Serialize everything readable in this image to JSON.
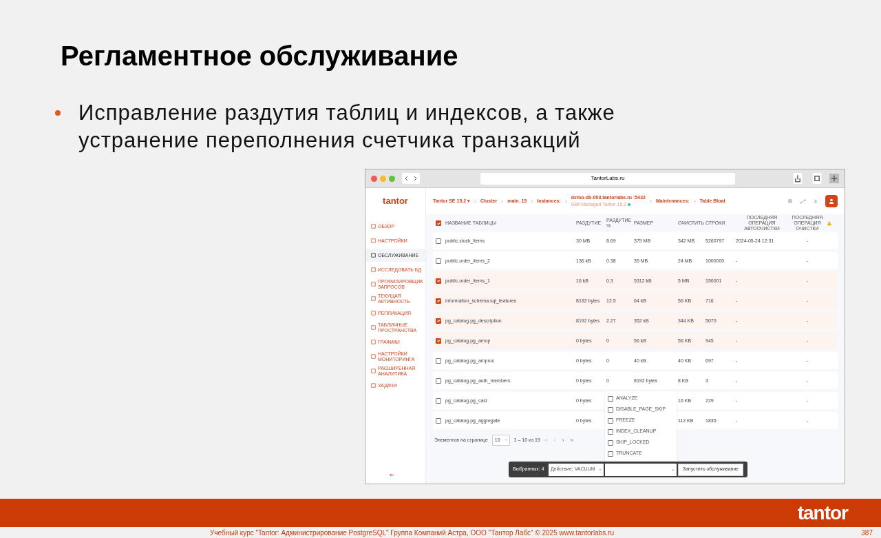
{
  "slide": {
    "title": "Регламентное обслуживание",
    "bullets": [
      "Исправление раздутия таблиц и индексов, а также устранение переполнения счетчика транзакций"
    ],
    "logo": "tantor",
    "footer": "Учебный курс \"Tantor: Администрирование PostgreSQL\" Группа Компаний Астра, ООО \"Тантор Лабс\" © 2025  www.tantorlabs.ru",
    "page_number": "387"
  },
  "browser": {
    "url": "TantorLabs.ru"
  },
  "app": {
    "logo": "tantor",
    "breadcrumbs": [
      {
        "text": "Tantor SE 15.2 ▾"
      },
      {
        "text": "Cluster"
      },
      {
        "text": "main_15"
      },
      {
        "text": "Instances:"
      },
      {
        "text": "demo-db-003.tantorlabs.ru :5432",
        "sub": "Self-Managed Tantor 15.2"
      },
      {
        "text": "Maintenances:"
      },
      {
        "text": "Table Bloat"
      }
    ],
    "sidebar": [
      {
        "label": "ОБЗОР",
        "selected": false
      },
      {
        "label": "НАСТРОЙКИ",
        "selected": false
      },
      {
        "label": "ОБСЛУЖИВАНИЕ",
        "selected": true
      },
      {
        "label": "ИССЛЕДОВАТЬ БД",
        "selected": false
      },
      {
        "label": "ПРОФИЛИРОВЩИК ЗАПРОСОВ",
        "selected": false
      },
      {
        "label": "ТЕКУЩАЯ АКТИВНОСТЬ",
        "selected": false
      },
      {
        "label": "РЕПЛИКАЦИЯ",
        "selected": false
      },
      {
        "label": "ТАБЛИЧНЫЕ ПРОСТРАНСТВА",
        "selected": false
      },
      {
        "label": "ГРАФИКИ",
        "selected": false
      },
      {
        "label": "НАСТРОЙКИ МОНИТОРИНГА",
        "selected": false
      },
      {
        "label": "РАСШИРЕННАЯ АНАЛИТИКА",
        "selected": false
      },
      {
        "label": "ЗАДАЧИ",
        "selected": false
      }
    ],
    "table": {
      "all_checked": true,
      "columns": [
        "НАЗВАНИЕ ТАБЛИЦЫ",
        "РАЗДУТИЕ",
        "РАЗДУТИЕ %",
        "РАЗМЕР",
        "ОЧИСТИТЬ",
        "СТРОКИ",
        "ПОСЛЕДНЯЯ ОПЕРАЦИЯ АВТООЧИСТКИ",
        "ПОСЛЕДНЯЯ ОПЕРАЦИЯ ОЧИСТКИ"
      ],
      "rows": [
        {
          "selected": false,
          "cells": [
            "public.stock_items",
            "30 MB",
            "8.69",
            "375 MB",
            "342 MB",
            "5260797",
            "2024-05-24 12:31",
            "-"
          ]
        },
        {
          "selected": false,
          "cells": [
            "public.order_items_2",
            "136 kB",
            "0.38",
            "35 MB",
            "24 MB",
            "1000000",
            "-",
            "-"
          ]
        },
        {
          "selected": true,
          "cells": [
            "public.order_items_1",
            "16 kB",
            "0.3",
            "5312 kB",
            "5 MB",
            "150001",
            "-",
            "-"
          ]
        },
        {
          "selected": true,
          "cells": [
            "information_schema.sql_features",
            "8192 bytes",
            "12.5",
            "64 kB",
            "56 KB",
            "716",
            "-",
            "-"
          ]
        },
        {
          "selected": true,
          "cells": [
            "pg_catalog.pg_description",
            "8192 bytes",
            "2.27",
            "352 kB",
            "344 KB",
            "5070",
            "-",
            "-"
          ]
        },
        {
          "selected": true,
          "cells": [
            "pg_catalog.pg_amop",
            "0 bytes",
            "0",
            "56 kB",
            "56 KB",
            "945",
            "-",
            "-"
          ]
        },
        {
          "selected": false,
          "cells": [
            "pg_catalog.pg_amproc",
            "0 bytes",
            "0",
            "40 kB",
            "40 KB",
            "697",
            "-",
            "-"
          ]
        },
        {
          "selected": false,
          "cells": [
            "pg_catalog.pg_auth_members",
            "0 bytes",
            "0",
            "8192 bytes",
            "8 KB",
            "3",
            "-",
            "-"
          ]
        },
        {
          "selected": false,
          "cells": [
            "pg_catalog.pg_cast",
            "0 bytes",
            null,
            null,
            "16 KB",
            "229",
            "-",
            "-"
          ]
        },
        {
          "selected": false,
          "cells": [
            "pg_catalog.pg_aggregate",
            "0 bytes",
            null,
            null,
            "112 KB",
            "1835",
            "-",
            "-"
          ]
        }
      ]
    },
    "pagination": {
      "label": "Элементов на странице",
      "page_size": "10",
      "range": "1 – 10 из 19"
    },
    "action_bar": {
      "selected_count": "Выбранных: 4",
      "action": "Действие: VACUUM",
      "run_button": "Запустить обслуживание"
    },
    "options": [
      {
        "label": "ANALYZE",
        "checked": false
      },
      {
        "label": "DISABLE_PAGE_SKIP",
        "checked": false
      },
      {
        "label": "FREEZE",
        "checked": false
      },
      {
        "label": "INDEX_CLEANUP",
        "checked": false
      },
      {
        "label": "SKIP_LOCKED",
        "checked": false
      },
      {
        "label": "TRUNCATE",
        "checked": false
      }
    ]
  }
}
